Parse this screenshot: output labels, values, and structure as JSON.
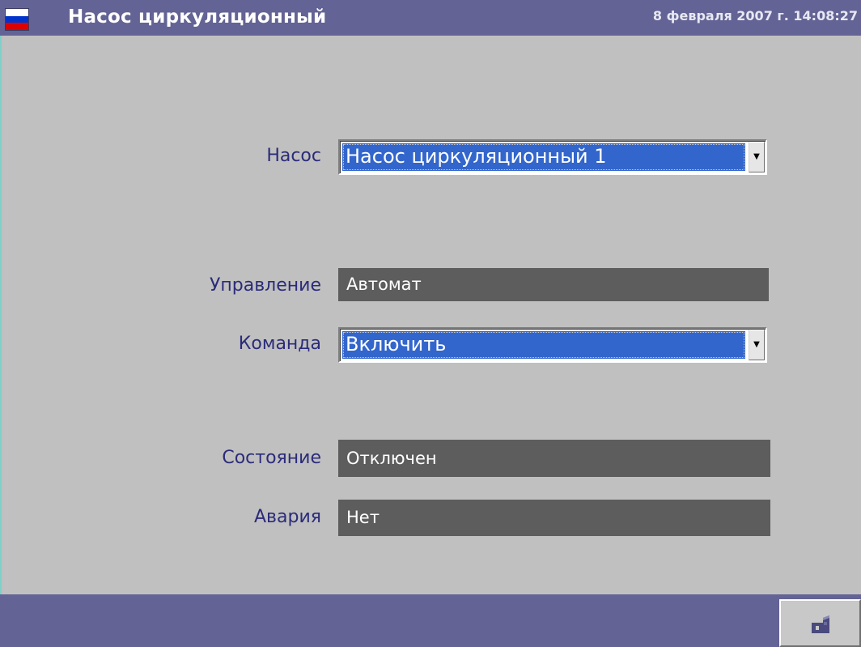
{
  "titlebar": {
    "title": "Насос циркуляционный",
    "datetime": "8 февраля 2007 г. 14:08:27",
    "flag_icon": "russian-flag-icon",
    "flag_colors": [
      "#ffffff",
      "#0033cc",
      "#dd0000"
    ],
    "background_color": "#636395"
  },
  "form": {
    "pump": {
      "label": "Насос",
      "value": "Насос циркуляционный 1"
    },
    "control": {
      "label": "Управление",
      "value": "Автомат"
    },
    "command": {
      "label": "Команда",
      "value": "Включить"
    },
    "state": {
      "label": "Состояние",
      "value": "Отключен"
    },
    "alarm": {
      "label": "Авария",
      "value": "Нет"
    }
  },
  "colors": {
    "label_text": "#2b2b7a",
    "selected_value_bg": "#3366cc",
    "readout_bg": "#5d5d5d",
    "panel_bg": "#c0c0c0"
  },
  "bottombar": {
    "home_icon": "home-icon"
  }
}
